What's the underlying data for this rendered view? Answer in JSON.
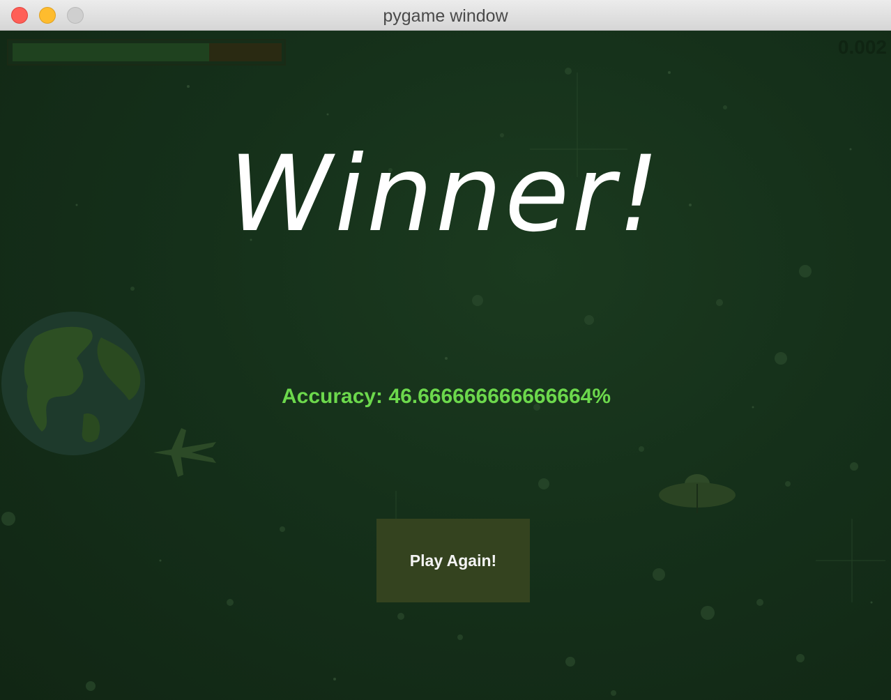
{
  "window": {
    "title": "pygame window"
  },
  "hud": {
    "health_level": 0.73,
    "score": "0.002"
  },
  "game_over": {
    "heading": "Winner!",
    "accuracy_text": "Accuracy: 46.666666666666664%"
  },
  "actions": {
    "play_again_label": "Play Again!"
  },
  "icons": [
    "planet-earth-icon",
    "fighter-jet-icon",
    "ufo-icon"
  ],
  "colors": {
    "background": "#15301a",
    "heading": "#ffffff",
    "accuracy": "#6cd84c",
    "button_bg": "#34431f",
    "button_text": "#f4f4f4",
    "health_fill": "#1f421f",
    "health_empty": "#2a2a12"
  }
}
